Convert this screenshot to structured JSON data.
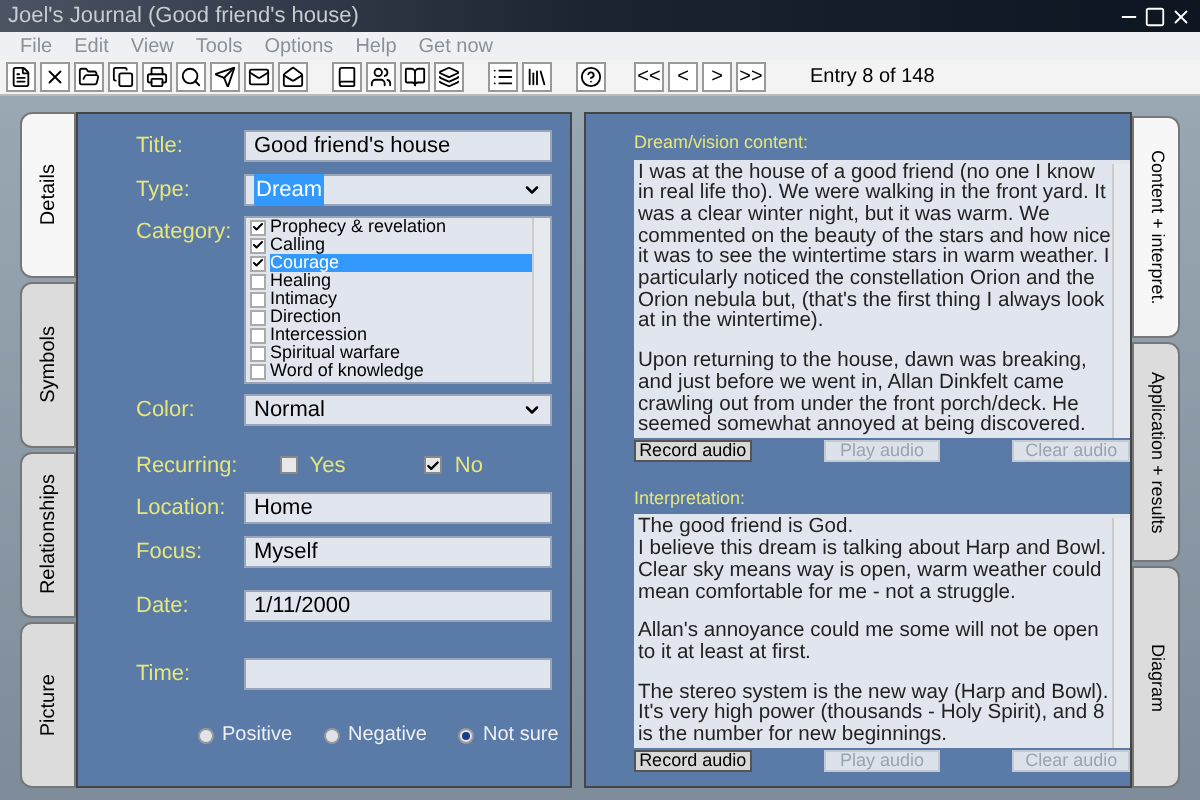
{
  "window": {
    "title": "Joel's Journal  (Good friend's house)"
  },
  "menu": [
    "File",
    "Edit",
    "View",
    "Tools",
    "Options",
    "Help",
    "Get now"
  ],
  "toolbar": {
    "nav": [
      "<<",
      "<",
      ">",
      ">>"
    ],
    "entry": "Entry 8 of 148"
  },
  "left_tabs": [
    {
      "label": "Details",
      "selected": true
    },
    {
      "label": "Symbols",
      "selected": false
    },
    {
      "label": "Relationships",
      "selected": false
    },
    {
      "label": "Picture",
      "selected": false
    }
  ],
  "details": {
    "title": {
      "label": "Title:",
      "value": "Good friend's house"
    },
    "type": {
      "label": "Type:",
      "value": "Dream"
    },
    "category": {
      "label": "Category:",
      "items": [
        {
          "label": "Prophecy & revelation",
          "checked": true,
          "selected": false
        },
        {
          "label": "Calling",
          "checked": true,
          "selected": false
        },
        {
          "label": "Courage",
          "checked": true,
          "selected": true
        },
        {
          "label": "Healing",
          "checked": false,
          "selected": false
        },
        {
          "label": "Intimacy",
          "checked": false,
          "selected": false
        },
        {
          "label": "Direction",
          "checked": false,
          "selected": false
        },
        {
          "label": "Intercession",
          "checked": false,
          "selected": false
        },
        {
          "label": "Spiritual warfare",
          "checked": false,
          "selected": false
        },
        {
          "label": "Word of knowledge",
          "checked": false,
          "selected": false
        }
      ]
    },
    "color": {
      "label": "Color:",
      "value": "Normal"
    },
    "recurring": {
      "label": "Recurring:",
      "options": [
        {
          "label": "Yes",
          "checked": false
        },
        {
          "label": "No",
          "checked": true
        }
      ]
    },
    "location": {
      "label": "Location:",
      "value": "Home"
    },
    "focus": {
      "label": "Focus:",
      "value": "Myself"
    },
    "date": {
      "label": "Date:",
      "value": "1/11/2000"
    },
    "time": {
      "label": "Time:"
    },
    "outlook": [
      {
        "label": "Positive",
        "selected": false
      },
      {
        "label": "Negative",
        "selected": false
      },
      {
        "label": "Not sure",
        "selected": true
      }
    ]
  },
  "content": {
    "label": "Dream/vision content:",
    "paragraphs": [
      "I was at the house of a good friend (no one I know in real life tho). We were walking in the front yard. It was a clear winter night, but it was warm. We commented on the beauty of the stars and how nice it was to see the wintertime stars in warm weather. I particularly noticed the constellation Orion and the Orion nebula but, (that's the first thing I always look at in the wintertime).",
      "Upon returning to the house, dawn was breaking, and just before we went in, Allan Dinkfelt came crawling out from under the front porch/deck. He seemed somewhat annoyed at being discovered."
    ],
    "buttons": [
      {
        "label": "Record audio",
        "disabled": false
      },
      {
        "label": "Play audio",
        "disabled": true
      },
      {
        "label": "Clear audio",
        "disabled": true
      }
    ]
  },
  "interpretation": {
    "label": "Interpretation:",
    "paragraphs": [
      "The good friend is God.\nI believe this dream is talking about Harp and Bowl. Clear sky means way is open, warm weather could mean comfortable for me - not a struggle.",
      "Allan's annoyance could me some will not be open to it at least at first.",
      "The stereo system is the new way (Harp and Bowl). It's very high power (thousands - Holy Spirit), and 8 is the number for new beginnings."
    ],
    "buttons": [
      {
        "label": "Record audio",
        "disabled": false
      },
      {
        "label": "Play audio",
        "disabled": true
      },
      {
        "label": "Clear audio",
        "disabled": true
      }
    ]
  },
  "right_tabs": [
    {
      "label": "Content + interpret.",
      "selected": true
    },
    {
      "label": "Application + results",
      "selected": false
    },
    {
      "label": "Diagram",
      "selected": false
    }
  ]
}
